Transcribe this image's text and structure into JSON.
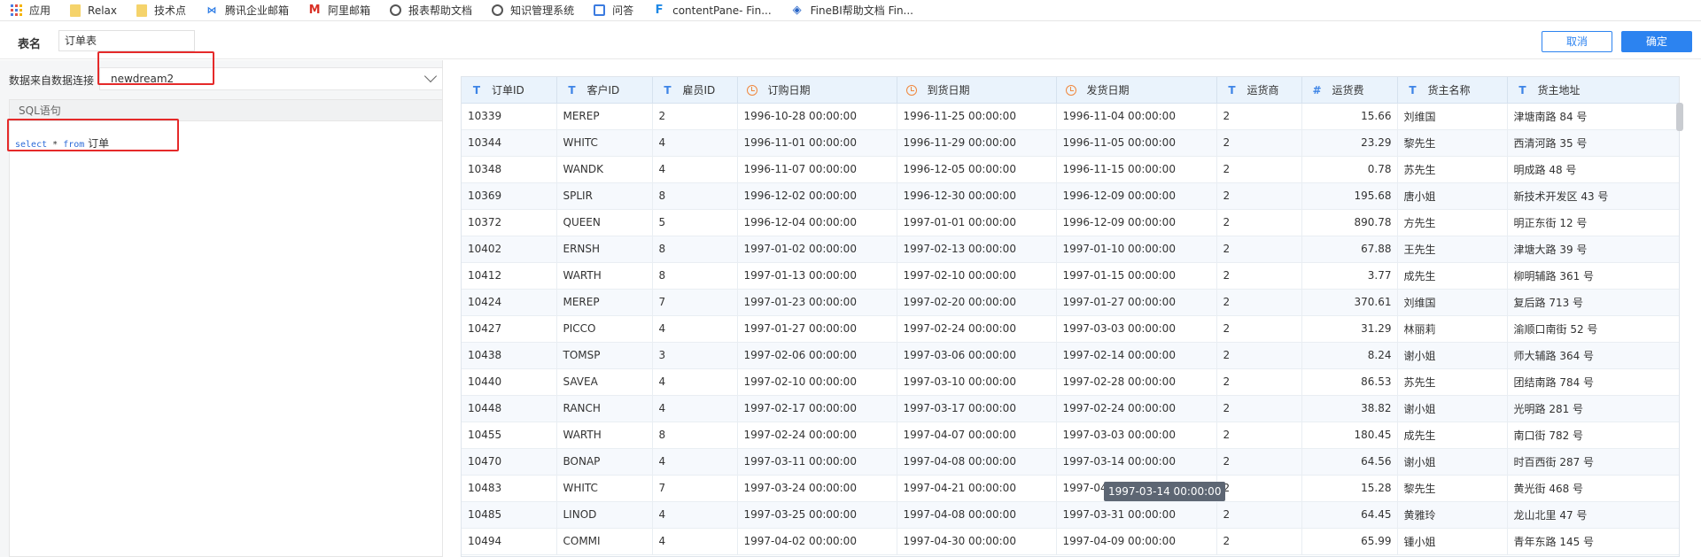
{
  "bookmarks": [
    {
      "icon": "apps-grid-icon",
      "label": "应用"
    },
    {
      "icon": "folder-icon",
      "label": "Relax"
    },
    {
      "icon": "folder-icon",
      "label": "技术点"
    },
    {
      "icon": "tencent-mail-icon",
      "label": "腾讯企业邮箱"
    },
    {
      "icon": "aliyun-mail-icon",
      "label": "阿里邮箱"
    },
    {
      "icon": "globe-icon",
      "label": "报表帮助文档"
    },
    {
      "icon": "globe-icon",
      "label": "知识管理系统"
    },
    {
      "icon": "question-icon",
      "label": "问答"
    },
    {
      "icon": "finereport-icon",
      "label": "contentPane- Fin..."
    },
    {
      "icon": "finebi-icon",
      "label": "FineBI帮助文档 Fin..."
    }
  ],
  "header": {
    "table_name_label": "表名",
    "table_name_value": "订单表",
    "cancel_label": "取消",
    "confirm_label": "确定"
  },
  "left_panel": {
    "connection_label": "数据来自数据连接",
    "connection_value": "newdream2",
    "sql_title": "SQL语句",
    "sql_select": "select",
    "sql_star": " * ",
    "sql_from": "from",
    "sql_table": " 订单"
  },
  "grid": {
    "columns": [
      {
        "type": "T",
        "label": "订单ID"
      },
      {
        "type": "T",
        "label": "客户ID"
      },
      {
        "type": "T",
        "label": "雇员ID"
      },
      {
        "type": "date",
        "label": "订购日期"
      },
      {
        "type": "date",
        "label": "到货日期"
      },
      {
        "type": "date",
        "label": "发货日期"
      },
      {
        "type": "T",
        "label": "运货商"
      },
      {
        "type": "#",
        "label": "运货费"
      },
      {
        "type": "T",
        "label": "货主名称"
      },
      {
        "type": "T",
        "label": "货主地址"
      }
    ],
    "rows": [
      [
        "10339",
        "MEREP",
        "2",
        "1996-10-28 00:00:00",
        "1996-11-25 00:00:00",
        "1996-11-04 00:00:00",
        "2",
        "15.66",
        "刘维国",
        "津塘南路 84 号"
      ],
      [
        "10344",
        "WHITC",
        "4",
        "1996-11-01 00:00:00",
        "1996-11-29 00:00:00",
        "1996-11-05 00:00:00",
        "2",
        "23.29",
        "黎先生",
        "西清河路 35 号"
      ],
      [
        "10348",
        "WANDK",
        "4",
        "1996-11-07 00:00:00",
        "1996-12-05 00:00:00",
        "1996-11-15 00:00:00",
        "2",
        "0.78",
        "苏先生",
        "明成路 48 号"
      ],
      [
        "10369",
        "SPLIR",
        "8",
        "1996-12-02 00:00:00",
        "1996-12-30 00:00:00",
        "1996-12-09 00:00:00",
        "2",
        "195.68",
        "唐小姐",
        "新技术开发区 43 号"
      ],
      [
        "10372",
        "QUEEN",
        "5",
        "1996-12-04 00:00:00",
        "1997-01-01 00:00:00",
        "1996-12-09 00:00:00",
        "2",
        "890.78",
        "方先生",
        "明正东街 12 号"
      ],
      [
        "10402",
        "ERNSH",
        "8",
        "1997-01-02 00:00:00",
        "1997-02-13 00:00:00",
        "1997-01-10 00:00:00",
        "2",
        "67.88",
        "王先生",
        "津塘大路 39 号"
      ],
      [
        "10412",
        "WARTH",
        "8",
        "1997-01-13 00:00:00",
        "1997-02-10 00:00:00",
        "1997-01-15 00:00:00",
        "2",
        "3.77",
        "成先生",
        "柳明辅路 361 号"
      ],
      [
        "10424",
        "MEREP",
        "7",
        "1997-01-23 00:00:00",
        "1997-02-20 00:00:00",
        "1997-01-27 00:00:00",
        "2",
        "370.61",
        "刘维国",
        "复后路 713 号"
      ],
      [
        "10427",
        "PICCO",
        "4",
        "1997-01-27 00:00:00",
        "1997-02-24 00:00:00",
        "1997-03-03 00:00:00",
        "2",
        "31.29",
        "林丽莉",
        "渝顺口南街 52 号"
      ],
      [
        "10438",
        "TOMSP",
        "3",
        "1997-02-06 00:00:00",
        "1997-03-06 00:00:00",
        "1997-02-14 00:00:00",
        "2",
        "8.24",
        "谢小姐",
        "师大辅路 364 号"
      ],
      [
        "10440",
        "SAVEA",
        "4",
        "1997-02-10 00:00:00",
        "1997-03-10 00:00:00",
        "1997-02-28 00:00:00",
        "2",
        "86.53",
        "苏先生",
        "团结南路 784 号"
      ],
      [
        "10448",
        "RANCH",
        "4",
        "1997-02-17 00:00:00",
        "1997-03-17 00:00:00",
        "1997-02-24 00:00:00",
        "2",
        "38.82",
        "谢小姐",
        "光明路 281 号"
      ],
      [
        "10455",
        "WARTH",
        "8",
        "1997-02-24 00:00:00",
        "1997-04-07 00:00:00",
        "1997-03-03 00:00:00",
        "2",
        "180.45",
        "成先生",
        "南口街 782 号"
      ],
      [
        "10470",
        "BONAP",
        "4",
        "1997-03-11 00:00:00",
        "1997-04-08 00:00:00",
        "1997-03-14 00:00:00",
        "2",
        "64.56",
        "谢小姐",
        "时百西街 287 号"
      ],
      [
        "10483",
        "WHITC",
        "7",
        "1997-03-24 00:00:00",
        "1997-04-21 00:00:00",
        "1997-04-",
        "2",
        "15.28",
        "黎先生",
        "黄光街 468 号"
      ],
      [
        "10485",
        "LINOD",
        "4",
        "1997-03-25 00:00:00",
        "1997-04-08 00:00:00",
        "1997-03-31 00:00:00",
        "2",
        "64.45",
        "黄雅玲",
        "龙山北里 47 号"
      ],
      [
        "10494",
        "COMMI",
        "4",
        "1997-04-02 00:00:00",
        "1997-04-30 00:00:00",
        "1997-04-09 00:00:00",
        "2",
        "65.99",
        "锺小姐",
        "青年东路 145 号"
      ]
    ],
    "tooltip": "1997-03-14 00:00:00"
  }
}
